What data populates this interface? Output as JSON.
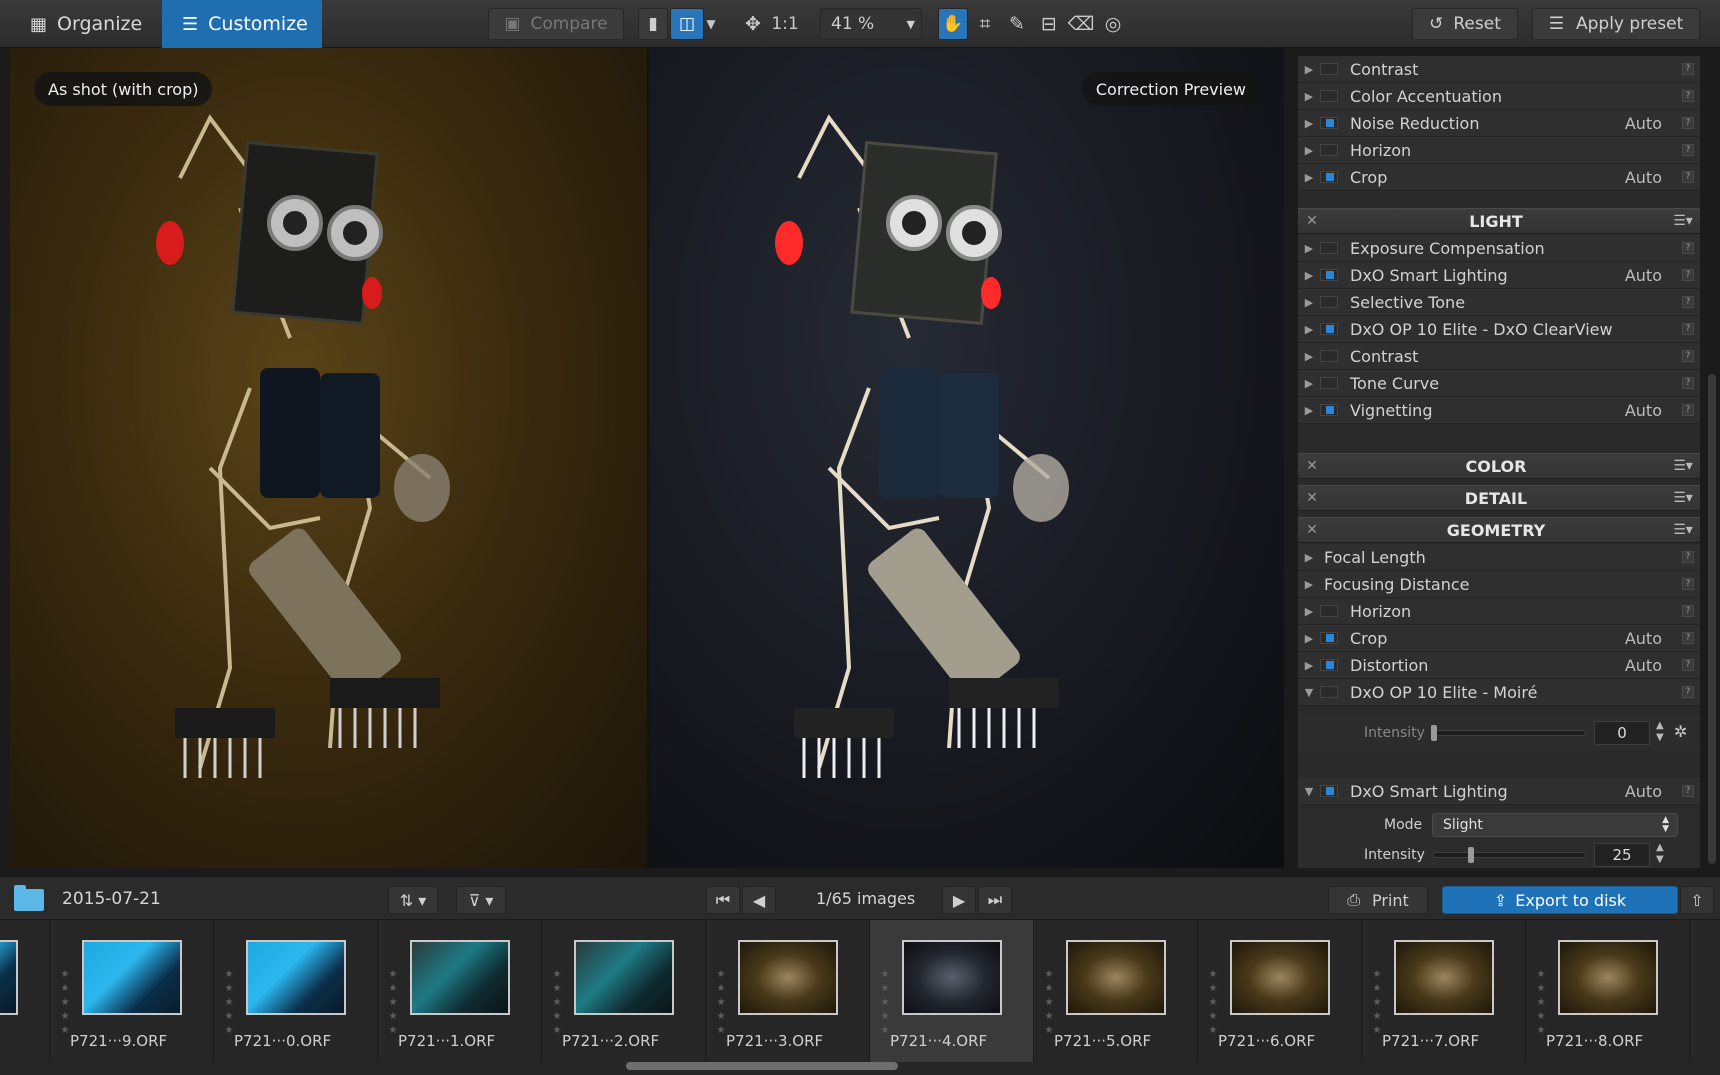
{
  "topbar": {
    "tab_organize": "Organize",
    "tab_customize": "Customize",
    "compare": "Compare",
    "one_to_one": "1:1",
    "zoom": "41 %",
    "reset": "Reset",
    "apply_preset": "Apply preset"
  },
  "viewer": {
    "left_label": "As shot (with crop)",
    "right_label": "Correction Preview"
  },
  "panel": {
    "top_rows": [
      {
        "label": "Contrast",
        "on": false,
        "auto": ""
      },
      {
        "label": "Color Accentuation",
        "on": false,
        "auto": ""
      },
      {
        "label": "Noise Reduction",
        "on": true,
        "auto": "Auto"
      },
      {
        "label": "Horizon",
        "on": false,
        "auto": ""
      },
      {
        "label": "Crop",
        "on": true,
        "auto": "Auto"
      }
    ],
    "light_title": "LIGHT",
    "light_rows": [
      {
        "label": "Exposure Compensation",
        "on": false,
        "auto": ""
      },
      {
        "label": "DxO Smart Lighting",
        "on": true,
        "auto": "Auto"
      },
      {
        "label": "Selective Tone",
        "on": false,
        "auto": ""
      },
      {
        "label": "DxO OP 10 Elite - DxO ClearView",
        "on": true,
        "auto": ""
      },
      {
        "label": "Contrast",
        "on": false,
        "auto": ""
      },
      {
        "label": "Tone Curve",
        "on": false,
        "auto": ""
      },
      {
        "label": "Vignetting",
        "on": true,
        "auto": "Auto"
      }
    ],
    "color_title": "COLOR",
    "detail_title": "DETAIL",
    "geometry_title": "GEOMETRY",
    "geometry_rows": [
      {
        "label": "Focal Length"
      },
      {
        "label": "Focusing Distance"
      },
      {
        "label": "Horizon",
        "on": false,
        "auto": ""
      },
      {
        "label": "Crop",
        "on": true,
        "auto": "Auto"
      },
      {
        "label": "Distortion",
        "on": true,
        "auto": "Auto"
      },
      {
        "label": "DxO OP 10 Elite - Moiré",
        "on": false,
        "auto": ""
      }
    ],
    "moire_intensity_label": "Intensity",
    "moire_intensity_value": "0",
    "smart_lighting": {
      "label": "DxO Smart Lighting",
      "auto": "Auto"
    },
    "mode_label": "Mode",
    "mode_value": "Slight",
    "sl_intensity_label": "Intensity",
    "sl_intensity_value": "25",
    "sl_intensity_fraction": 0.25
  },
  "filmbar": {
    "folder": "2015-07-21",
    "counter": "1/65 images",
    "print": "Print",
    "export": "Export to disk"
  },
  "filmstrip": [
    {
      "name": ".ORF",
      "kind": "blue"
    },
    {
      "name": "P721···9.ORF",
      "kind": "blue"
    },
    {
      "name": "P721···0.ORF",
      "kind": "blue"
    },
    {
      "name": "P721···1.ORF",
      "kind": "teal"
    },
    {
      "name": "P721···2.ORF",
      "kind": "teal"
    },
    {
      "name": "P721···3.ORF",
      "kind": "robot"
    },
    {
      "name": "P721···4.ORF",
      "kind": "robotdark",
      "selected": true
    },
    {
      "name": "P721···5.ORF",
      "kind": "robot"
    },
    {
      "name": "P721···6.ORF",
      "kind": "robot"
    },
    {
      "name": "P721···7.ORF",
      "kind": "robot"
    },
    {
      "name": "P721···8.ORF",
      "kind": "robot"
    }
  ]
}
